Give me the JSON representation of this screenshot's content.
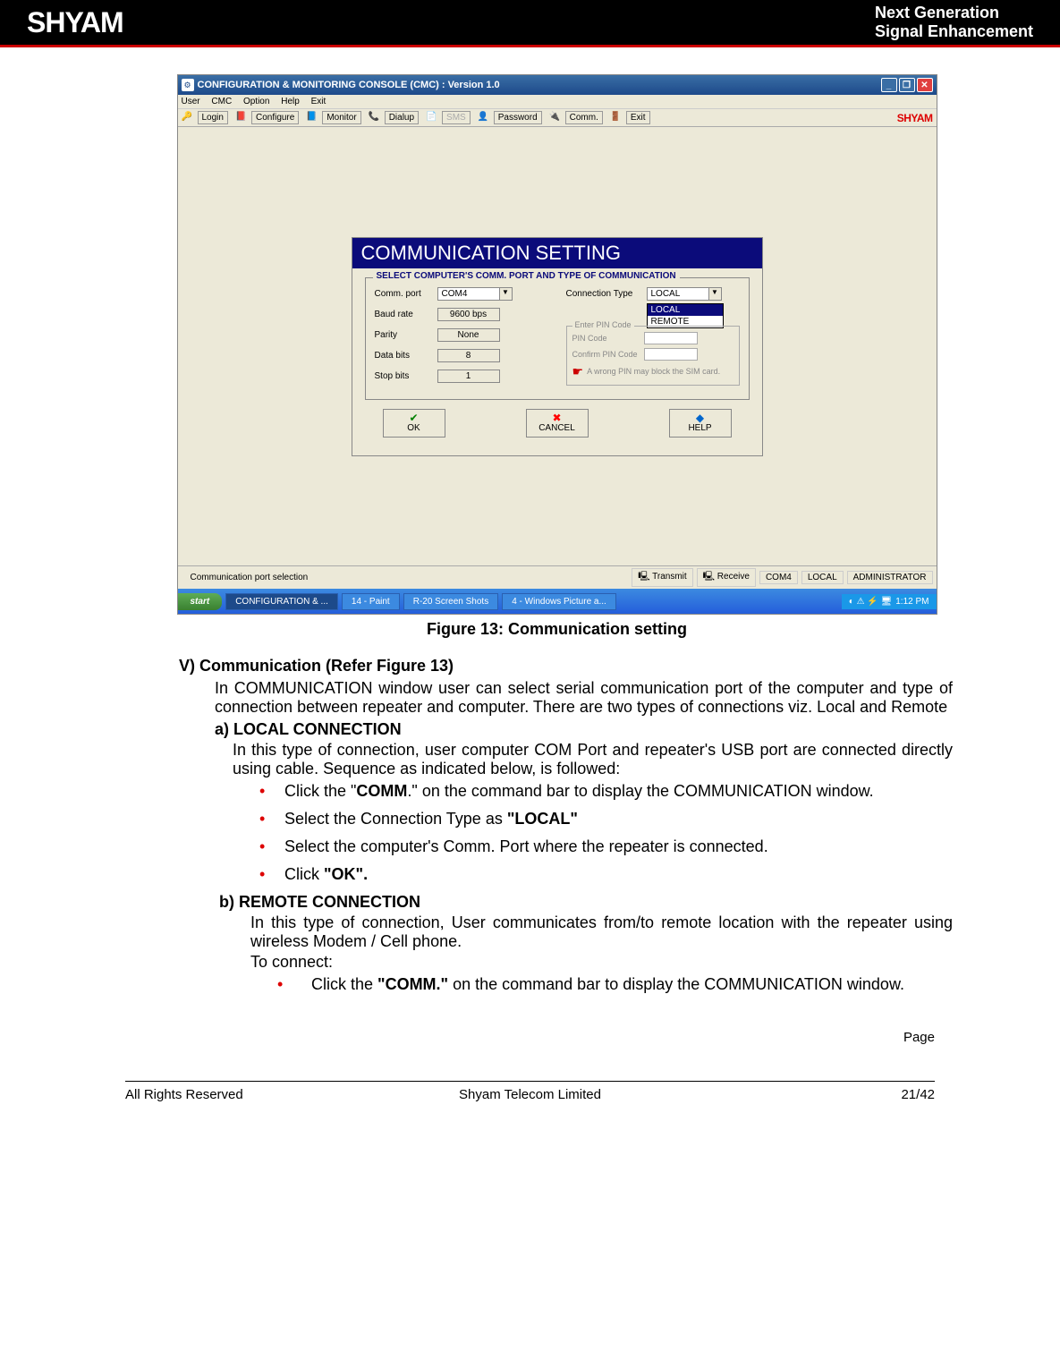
{
  "banner": {
    "logo": "SHYAM",
    "line1": "Next Generation",
    "line2": "Signal Enhancement"
  },
  "screenshot": {
    "title": "CONFIGURATION & MONITORING CONSOLE (CMC)  :  Version 1.0",
    "menu": {
      "user": "User",
      "cmc": "CMC",
      "option": "Option",
      "help": "Help",
      "exit": "Exit"
    },
    "toolbar": {
      "login": "Login",
      "configure": "Configure",
      "monitor": "Monitor",
      "dialup": "Dialup",
      "sms": "SMS",
      "password": "Password",
      "comm": "Comm.",
      "exit": "Exit",
      "brand": "SHYAM"
    },
    "dialog": {
      "title": "COMMUNICATION SETTING",
      "group_title": "SELECT COMPUTER'S COMM. PORT AND TYPE OF COMMUNICATION",
      "comm_port_label": "Comm. port",
      "comm_port_value": "COM4",
      "baud_label": "Baud rate",
      "baud_value": "9600 bps",
      "parity_label": "Parity",
      "parity_value": "None",
      "data_bits_label": "Data bits",
      "data_bits_value": "8",
      "stop_bits_label": "Stop bits",
      "stop_bits_value": "1",
      "conn_type_label": "Connection Type",
      "conn_type_value": "LOCAL",
      "conn_options": {
        "local": "LOCAL",
        "remote": "REMOTE"
      },
      "enter_pin_group": "Enter PIN Code",
      "pin_code_label": "PIN Code",
      "confirm_pin_label": "Confirm PIN Code",
      "warning": "A wrong PIN may block the SIM card.",
      "ok": "OK",
      "cancel": "CANCEL",
      "help": "HELP"
    },
    "status": {
      "left": "Communication port selection",
      "transmit": "Transmit",
      "receive": "Receive",
      "port": "COM4",
      "mode": "LOCAL",
      "user": "ADMINISTRATOR"
    },
    "taskbar": {
      "start": "start",
      "item1": "CONFIGURATION & ...",
      "item2": "14 - Paint",
      "item3": "R-20 Screen Shots",
      "item4": "4 - Windows Picture a...",
      "time": "1:12 PM"
    }
  },
  "caption": "Figure 13: Communication setting",
  "body": {
    "heading_v": "V) Communication (Refer Figure 13)",
    "para_v": "In COMMUNICATION window user can select serial communication port of the computer and type of connection between repeater and computer. There are two types of connections viz. Local and Remote",
    "heading_a": "a) LOCAL CONNECTION",
    "para_a": "In this type of connection, user computer COM Port and repeater's USB port are connected directly using cable. Sequence as indicated below, is followed:",
    "bullet_a1_pre": "Click the \"",
    "bullet_a1_bold": "COMM",
    "bullet_a1_post": ".\" on the command bar to display the COMMUNICATION window.",
    "bullet_a2_pre": "Select the Connection Type as ",
    "bullet_a2_bold": "\"LOCAL\"",
    "bullet_a3": "Select the computer's Comm. Port where the repeater is connected.",
    "bullet_a4_pre": "Click  ",
    "bullet_a4_bold": "\"OK\".",
    "heading_b": "b) REMOTE CONNECTION",
    "para_b1": "In this type of connection, User communicates from/to remote location with the repeater using wireless Modem / Cell phone.",
    "para_b2": "To connect:",
    "bullet_b1_pre": "Click the ",
    "bullet_b1_bold": "\"COMM.\"",
    "bullet_b1_post": " on the command bar to display the COMMUNICATION window."
  },
  "footer": {
    "page_label": "Page",
    "left": "All Rights Reserved",
    "center": "Shyam Telecom Limited",
    "right": "21/42"
  }
}
